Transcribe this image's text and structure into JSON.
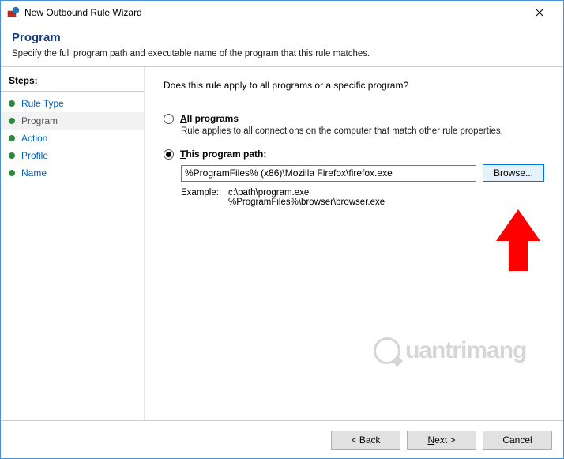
{
  "window": {
    "title": "New Outbound Rule Wizard"
  },
  "header": {
    "title": "Program",
    "subtitle": "Specify the full program path and executable name of the program that this rule matches."
  },
  "sidebar": {
    "title": "Steps:",
    "items": [
      {
        "label": "Rule Type"
      },
      {
        "label": "Program"
      },
      {
        "label": "Action"
      },
      {
        "label": "Profile"
      },
      {
        "label": "Name"
      }
    ]
  },
  "content": {
    "prompt": "Does this rule apply to all programs or a specific program?",
    "all_label_prefix": "A",
    "all_label_rest": "ll programs",
    "all_desc": "Rule applies to all connections on the computer that match other rule properties.",
    "this_label_prefix": "T",
    "this_label_rest": "his program path:",
    "path_value": "%ProgramFiles% (x86)\\Mozilla Firefox\\firefox.exe",
    "browse_label": "Browse...",
    "example_label": "Example:",
    "example_text": "c:\\path\\program.exe\n%ProgramFiles%\\browser\\browser.exe"
  },
  "footer": {
    "back": "< Back",
    "next": "Next >",
    "cancel": "Cancel"
  },
  "watermark": "uantrimang"
}
